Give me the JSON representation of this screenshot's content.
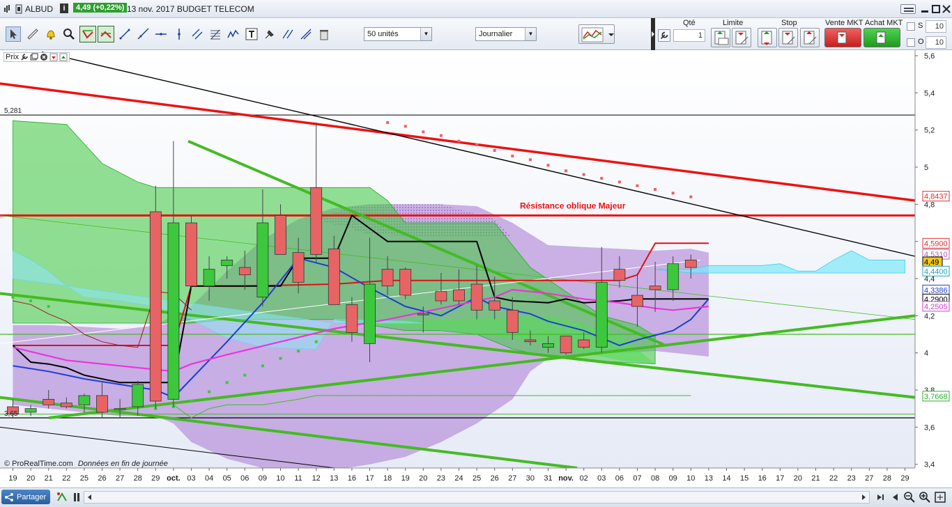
{
  "title": {
    "symbol": "ALBUD",
    "info_icon": "i",
    "price_change": "4,49 (+0,22%)",
    "date_name": "13 nov. 2017 BUDGET TELECOM"
  },
  "toolbar": {
    "units_select": "50 unités",
    "period_select": "Journalier",
    "qty_label": "Qté",
    "qty_value": "1",
    "limit_label": "Limite",
    "stop_label": "Stop",
    "sell_label": "Vente MKT",
    "buy_label": "Achat MKT",
    "s_label": "S",
    "s_value": "10",
    "o_label": "O",
    "o_value": "10"
  },
  "chart_header": {
    "label": "Prix"
  },
  "chart_data": {
    "type": "candlestick",
    "instrument": "ALBUD",
    "ylim": [
      3.38,
      5.63
    ],
    "yticks": [
      "5,6",
      "5,4",
      "5,2",
      "5",
      "4,8",
      "4,6",
      "4,4",
      "4,2",
      "4",
      "3,8",
      "3,6",
      "3,4"
    ],
    "xticks": [
      "19",
      "20",
      "21",
      "22",
      "25",
      "26",
      "27",
      "28",
      "29",
      "oct.",
      "03",
      "04",
      "05",
      "06",
      "09",
      "10",
      "11",
      "12",
      "13",
      "16",
      "17",
      "18",
      "19",
      "20",
      "23",
      "24",
      "25",
      "26",
      "27",
      "30",
      "31",
      "nov.",
      "02",
      "03",
      "06",
      "07",
      "08",
      "09",
      "10",
      "13",
      "14",
      "15",
      "16",
      "17",
      "20",
      "21",
      "22",
      "23",
      "27",
      "28",
      "29"
    ],
    "candles": [
      {
        "o": 3.71,
        "h": 3.75,
        "l": 3.65,
        "c": 3.67
      },
      {
        "o": 3.68,
        "h": 3.72,
        "l": 3.66,
        "c": 3.7
      },
      {
        "o": 3.75,
        "h": 3.8,
        "l": 3.7,
        "c": 3.72
      },
      {
        "o": 3.73,
        "h": 3.76,
        "l": 3.7,
        "c": 3.71
      },
      {
        "o": 3.72,
        "h": 3.78,
        "l": 3.68,
        "c": 3.77
      },
      {
        "o": 3.77,
        "h": 3.84,
        "l": 3.65,
        "c": 3.68
      },
      {
        "o": 3.7,
        "h": 3.75,
        "l": 3.65,
        "c": 3.7
      },
      {
        "o": 3.71,
        "h": 3.85,
        "l": 3.66,
        "c": 3.83
      },
      {
        "o": 4.76,
        "h": 4.9,
        "l": 3.7,
        "c": 3.74
      },
      {
        "o": 3.75,
        "h": 5.14,
        "l": 3.71,
        "c": 4.7
      },
      {
        "o": 4.7,
        "h": 4.74,
        "l": 4.34,
        "c": 4.36
      },
      {
        "o": 4.36,
        "h": 4.52,
        "l": 4.28,
        "c": 4.45
      },
      {
        "o": 4.47,
        "h": 4.52,
        "l": 4.4,
        "c": 4.5
      },
      {
        "o": 4.46,
        "h": 4.55,
        "l": 4.34,
        "c": 4.42
      },
      {
        "o": 4.3,
        "h": 4.88,
        "l": 4.25,
        "c": 4.7
      },
      {
        "o": 4.74,
        "h": 4.8,
        "l": 4.53,
        "c": 4.53
      },
      {
        "o": 4.54,
        "h": 4.62,
        "l": 4.32,
        "c": 4.38
      },
      {
        "o": 4.89,
        "h": 5.24,
        "l": 4.49,
        "c": 4.53
      },
      {
        "o": 4.56,
        "h": 4.63,
        "l": 4.26,
        "c": 4.26
      },
      {
        "o": 4.26,
        "h": 4.3,
        "l": 4.06,
        "c": 4.11
      },
      {
        "o": 4.05,
        "h": 4.62,
        "l": 3.95,
        "c": 4.37
      },
      {
        "o": 4.45,
        "h": 4.52,
        "l": 4.31,
        "c": 4.36
      },
      {
        "o": 4.45,
        "h": 4.46,
        "l": 4.29,
        "c": 4.31
      },
      {
        "o": 4.21,
        "h": 4.25,
        "l": 4.11,
        "c": 4.21
      },
      {
        "o": 4.33,
        "h": 4.43,
        "l": 4.26,
        "c": 4.28
      },
      {
        "o": 4.34,
        "h": 4.45,
        "l": 4.26,
        "c": 4.28
      },
      {
        "o": 4.37,
        "h": 4.47,
        "l": 4.18,
        "c": 4.23
      },
      {
        "o": 4.28,
        "h": 4.41,
        "l": 4.18,
        "c": 4.23
      },
      {
        "o": 4.23,
        "h": 4.3,
        "l": 4.07,
        "c": 4.11
      },
      {
        "o": 4.07,
        "h": 4.12,
        "l": 4.04,
        "c": 4.06
      },
      {
        "o": 4.03,
        "h": 4.09,
        "l": 4.0,
        "c": 4.05
      },
      {
        "o": 4.09,
        "h": 4.09,
        "l": 3.99,
        "c": 4.0
      },
      {
        "o": 4.07,
        "h": 4.11,
        "l": 4.02,
        "c": 4.03
      },
      {
        "o": 4.03,
        "h": 4.57,
        "l": 4.0,
        "c": 4.38
      },
      {
        "o": 4.45,
        "h": 4.52,
        "l": 4.35,
        "c": 4.39
      },
      {
        "o": 4.31,
        "h": 4.43,
        "l": 4.14,
        "c": 4.25
      },
      {
        "o": 4.36,
        "h": 4.49,
        "l": 4.22,
        "c": 4.34
      },
      {
        "o": 4.34,
        "h": 4.52,
        "l": 4.28,
        "c": 4.48
      },
      {
        "o": 4.5,
        "h": 4.53,
        "l": 4.4,
        "c": 4.46
      }
    ],
    "price_labels": [
      {
        "text": "4,8437",
        "color": "#e03030"
      },
      {
        "text": "4,5900",
        "color": "#e03030"
      },
      {
        "text": "4,5310",
        "color": "#b060b0"
      },
      {
        "text": "4,49",
        "color": "#000000"
      },
      {
        "text": "4,4400",
        "color": "#20a0c0"
      },
      {
        "text": "4,3386",
        "color": "#2040d0"
      },
      {
        "text": "4,2900",
        "color": "#000000"
      },
      {
        "text": "4,2505",
        "color": "#d040d0"
      },
      {
        "text": "3,7668",
        "color": "#30b030"
      }
    ],
    "level_labels": [
      "5,281",
      "3,65"
    ],
    "annotation": "Résistance oblique Majeur",
    "colors": {
      "up": "#3cc83c",
      "down": "#e86464",
      "resistance": "#ee1111",
      "trend": "#44bb22",
      "cloud_green": "#44c044",
      "cloud_purple": "#9944cc",
      "bollinger": "#7733cc"
    }
  },
  "footer": {
    "credit_text": "© ProRealTime.com",
    "delay_text": "Données en fin de journée",
    "share_label": "Partager"
  }
}
